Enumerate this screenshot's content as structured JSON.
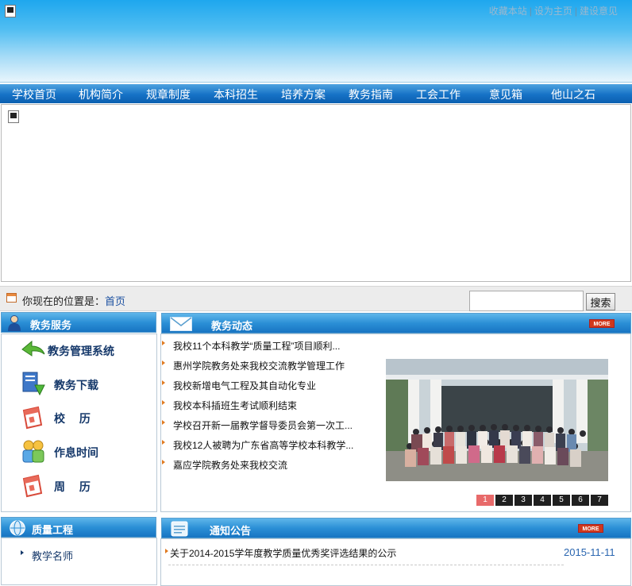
{
  "header": {
    "top_links": [
      "收藏本站",
      "设为主页",
      "建设意见"
    ],
    "link_separator": "|"
  },
  "nav": {
    "items": [
      "学校首页",
      "机构简介",
      "规章制度",
      "本科招生",
      "培养方案",
      "教务指南",
      "工会工作",
      "意见箱",
      "他山之石"
    ]
  },
  "location": {
    "prefix": "你现在的位置是：",
    "home": "首页"
  },
  "search": {
    "value": "",
    "button_label": "搜索"
  },
  "services": {
    "title": "教务服务",
    "items": [
      {
        "label": "教务管理系统",
        "icon": "green-arrow-icon"
      },
      {
        "label": "教务下载",
        "icon": "download-icon"
      },
      {
        "label": "校　 历",
        "icon": "calendar-icon"
      },
      {
        "label": "作息时间",
        "icon": "people-icon"
      },
      {
        "label": "周　 历",
        "icon": "calendar-icon"
      }
    ]
  },
  "news": {
    "title": "教务动态",
    "more_label": "MORE",
    "items": [
      "我校11个本科教学“质量工程”项目顺利...",
      "惠州学院教务处来我校交流教学管理工作",
      "我校新增电气工程及其自动化专业",
      "我校本科插班生考试顺利结束",
      "学校召开新一届教学督导委员会第一次工...",
      "我校12人被聘为广东省高等学校本科教学...",
      "嘉应学院教务处来我校交流"
    ],
    "pager": [
      "1",
      "2",
      "3",
      "4",
      "5",
      "6",
      "7"
    ],
    "active_page": "1"
  },
  "quality": {
    "title": "质量工程",
    "items": [
      "教学名师"
    ]
  },
  "notices": {
    "title": "通知公告",
    "more_label": "MORE",
    "items": [
      {
        "title": "关于2014-2015学年度教学质量优秀奖评选结果的公示",
        "date": "2015-11-11"
      }
    ]
  },
  "colors": {
    "nav_blue": "#1672c6",
    "header_blue": "#1ea7ee",
    "service_text": "#15386a",
    "date_blue": "#2a66b0",
    "more_red": "#d0381c",
    "pager_active": "#e86a6a"
  }
}
